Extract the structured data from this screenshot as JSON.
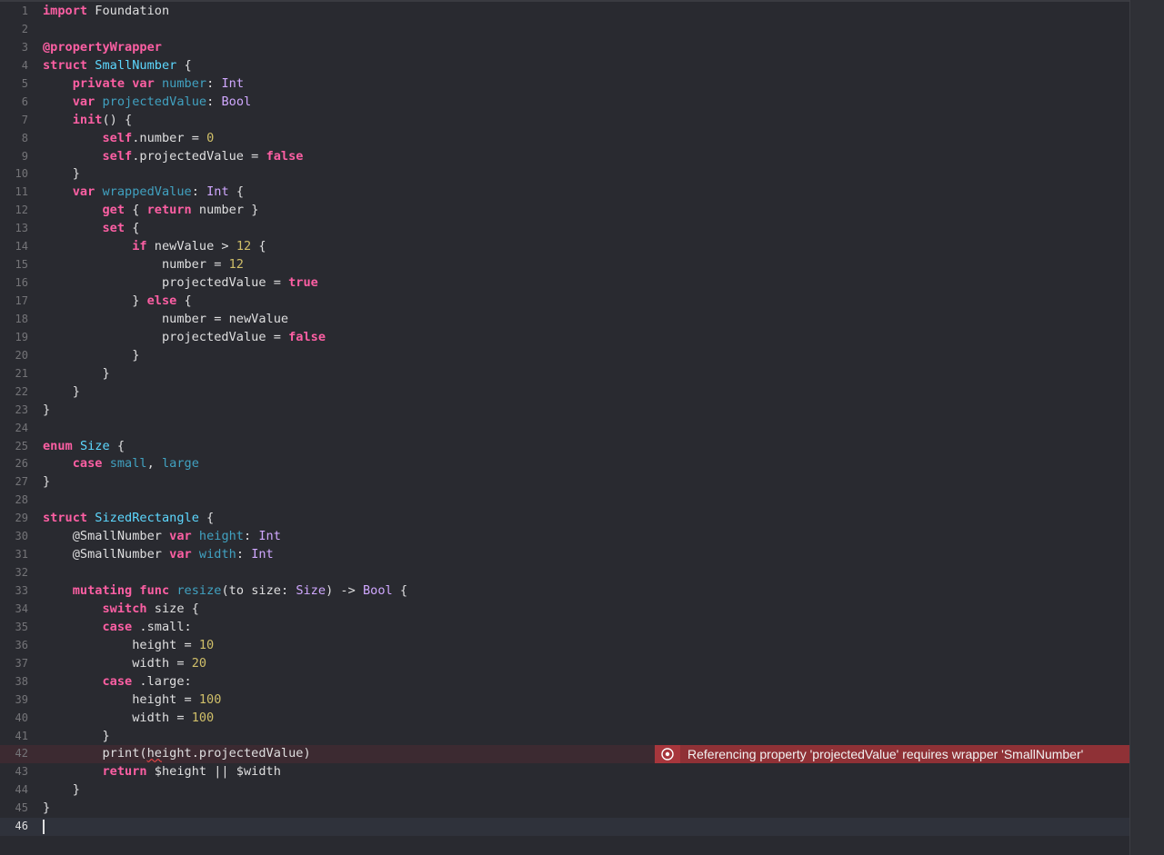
{
  "editor": {
    "language": "Swift",
    "current_line": 46,
    "colors": {
      "background": "#292a30",
      "keyword": "#fc5fa3",
      "type": "#5dd8ff",
      "type_ref": "#d0a8ff",
      "declaration": "#41a1c0",
      "number": "#d0bf69",
      "plain": "#dfdfe0",
      "line_number": "#747478",
      "error_banner": "#8f3136"
    },
    "lines": [
      {
        "n": "1",
        "tokens": [
          {
            "t": "import",
            "c": "kw"
          },
          {
            "t": " Foundation",
            "c": "plain"
          }
        ]
      },
      {
        "n": "2",
        "tokens": []
      },
      {
        "n": "3",
        "tokens": [
          {
            "t": "@propertyWrapper",
            "c": "attr"
          }
        ]
      },
      {
        "n": "4",
        "tokens": [
          {
            "t": "struct",
            "c": "kw"
          },
          {
            "t": " ",
            "c": "plain"
          },
          {
            "t": "SmallNumber",
            "c": "type"
          },
          {
            "t": " {",
            "c": "plain"
          }
        ]
      },
      {
        "n": "5",
        "tokens": [
          {
            "t": "    ",
            "c": "plain"
          },
          {
            "t": "private",
            "c": "kw"
          },
          {
            "t": " ",
            "c": "plain"
          },
          {
            "t": "var",
            "c": "kw"
          },
          {
            "t": " ",
            "c": "plain"
          },
          {
            "t": "number",
            "c": "decl"
          },
          {
            "t": ": ",
            "c": "plain"
          },
          {
            "t": "Int",
            "c": "tref"
          }
        ]
      },
      {
        "n": "6",
        "tokens": [
          {
            "t": "    ",
            "c": "plain"
          },
          {
            "t": "var",
            "c": "kw"
          },
          {
            "t": " ",
            "c": "plain"
          },
          {
            "t": "projectedValue",
            "c": "decl"
          },
          {
            "t": ": ",
            "c": "plain"
          },
          {
            "t": "Bool",
            "c": "tref"
          }
        ]
      },
      {
        "n": "7",
        "tokens": [
          {
            "t": "    ",
            "c": "plain"
          },
          {
            "t": "init",
            "c": "kw"
          },
          {
            "t": "() {",
            "c": "plain"
          }
        ]
      },
      {
        "n": "8",
        "tokens": [
          {
            "t": "        ",
            "c": "plain"
          },
          {
            "t": "self",
            "c": "kw"
          },
          {
            "t": ".number = ",
            "c": "plain"
          },
          {
            "t": "0",
            "c": "num"
          }
        ]
      },
      {
        "n": "9",
        "tokens": [
          {
            "t": "        ",
            "c": "plain"
          },
          {
            "t": "self",
            "c": "kw"
          },
          {
            "t": ".projectedValue = ",
            "c": "plain"
          },
          {
            "t": "false",
            "c": "kw"
          }
        ]
      },
      {
        "n": "10",
        "tokens": [
          {
            "t": "    }",
            "c": "plain"
          }
        ]
      },
      {
        "n": "11",
        "tokens": [
          {
            "t": "    ",
            "c": "plain"
          },
          {
            "t": "var",
            "c": "kw"
          },
          {
            "t": " ",
            "c": "plain"
          },
          {
            "t": "wrappedValue",
            "c": "decl"
          },
          {
            "t": ": ",
            "c": "plain"
          },
          {
            "t": "Int",
            "c": "tref"
          },
          {
            "t": " {",
            "c": "plain"
          }
        ]
      },
      {
        "n": "12",
        "tokens": [
          {
            "t": "        ",
            "c": "plain"
          },
          {
            "t": "get",
            "c": "kw"
          },
          {
            "t": " { ",
            "c": "plain"
          },
          {
            "t": "return",
            "c": "kw"
          },
          {
            "t": " number }",
            "c": "plain"
          }
        ]
      },
      {
        "n": "13",
        "tokens": [
          {
            "t": "        ",
            "c": "plain"
          },
          {
            "t": "set",
            "c": "kw"
          },
          {
            "t": " {",
            "c": "plain"
          }
        ]
      },
      {
        "n": "14",
        "tokens": [
          {
            "t": "            ",
            "c": "plain"
          },
          {
            "t": "if",
            "c": "kw"
          },
          {
            "t": " newValue > ",
            "c": "plain"
          },
          {
            "t": "12",
            "c": "num"
          },
          {
            "t": " {",
            "c": "plain"
          }
        ]
      },
      {
        "n": "15",
        "tokens": [
          {
            "t": "                number = ",
            "c": "plain"
          },
          {
            "t": "12",
            "c": "num"
          }
        ]
      },
      {
        "n": "16",
        "tokens": [
          {
            "t": "                projectedValue = ",
            "c": "plain"
          },
          {
            "t": "true",
            "c": "kw"
          }
        ]
      },
      {
        "n": "17",
        "tokens": [
          {
            "t": "            } ",
            "c": "plain"
          },
          {
            "t": "else",
            "c": "kw"
          },
          {
            "t": " {",
            "c": "plain"
          }
        ]
      },
      {
        "n": "18",
        "tokens": [
          {
            "t": "                number = newValue",
            "c": "plain"
          }
        ]
      },
      {
        "n": "19",
        "tokens": [
          {
            "t": "                projectedValue = ",
            "c": "plain"
          },
          {
            "t": "false",
            "c": "kw"
          }
        ]
      },
      {
        "n": "20",
        "tokens": [
          {
            "t": "            }",
            "c": "plain"
          }
        ]
      },
      {
        "n": "21",
        "tokens": [
          {
            "t": "        }",
            "c": "plain"
          }
        ]
      },
      {
        "n": "22",
        "tokens": [
          {
            "t": "    }",
            "c": "plain"
          }
        ]
      },
      {
        "n": "23",
        "tokens": [
          {
            "t": "}",
            "c": "plain"
          }
        ]
      },
      {
        "n": "24",
        "tokens": []
      },
      {
        "n": "25",
        "tokens": [
          {
            "t": "enum",
            "c": "kw"
          },
          {
            "t": " ",
            "c": "plain"
          },
          {
            "t": "Size",
            "c": "type"
          },
          {
            "t": " {",
            "c": "plain"
          }
        ]
      },
      {
        "n": "26",
        "tokens": [
          {
            "t": "    ",
            "c": "plain"
          },
          {
            "t": "case",
            "c": "kw"
          },
          {
            "t": " ",
            "c": "plain"
          },
          {
            "t": "small",
            "c": "decl"
          },
          {
            "t": ", ",
            "c": "plain"
          },
          {
            "t": "large",
            "c": "decl"
          }
        ]
      },
      {
        "n": "27",
        "tokens": [
          {
            "t": "}",
            "c": "plain"
          }
        ]
      },
      {
        "n": "28",
        "tokens": []
      },
      {
        "n": "29",
        "tokens": [
          {
            "t": "struct",
            "c": "kw"
          },
          {
            "t": " ",
            "c": "plain"
          },
          {
            "t": "SizedRectangle",
            "c": "type"
          },
          {
            "t": " {",
            "c": "plain"
          }
        ]
      },
      {
        "n": "30",
        "tokens": [
          {
            "t": "    @SmallNumber ",
            "c": "plain"
          },
          {
            "t": "var",
            "c": "kw"
          },
          {
            "t": " ",
            "c": "plain"
          },
          {
            "t": "height",
            "c": "decl"
          },
          {
            "t": ": ",
            "c": "plain"
          },
          {
            "t": "Int",
            "c": "tref"
          }
        ]
      },
      {
        "n": "31",
        "tokens": [
          {
            "t": "    @SmallNumber ",
            "c": "plain"
          },
          {
            "t": "var",
            "c": "kw"
          },
          {
            "t": " ",
            "c": "plain"
          },
          {
            "t": "width",
            "c": "decl"
          },
          {
            "t": ": ",
            "c": "plain"
          },
          {
            "t": "Int",
            "c": "tref"
          }
        ]
      },
      {
        "n": "32",
        "tokens": []
      },
      {
        "n": "33",
        "tokens": [
          {
            "t": "    ",
            "c": "plain"
          },
          {
            "t": "mutating",
            "c": "kw"
          },
          {
            "t": " ",
            "c": "plain"
          },
          {
            "t": "func",
            "c": "kw"
          },
          {
            "t": " ",
            "c": "plain"
          },
          {
            "t": "resize",
            "c": "decl"
          },
          {
            "t": "(to size: ",
            "c": "plain"
          },
          {
            "t": "Size",
            "c": "tref"
          },
          {
            "t": ") -> ",
            "c": "plain"
          },
          {
            "t": "Bool",
            "c": "tref"
          },
          {
            "t": " {",
            "c": "plain"
          }
        ]
      },
      {
        "n": "34",
        "tokens": [
          {
            "t": "        ",
            "c": "plain"
          },
          {
            "t": "switch",
            "c": "kw"
          },
          {
            "t": " size {",
            "c": "plain"
          }
        ]
      },
      {
        "n": "35",
        "tokens": [
          {
            "t": "        ",
            "c": "plain"
          },
          {
            "t": "case",
            "c": "kw"
          },
          {
            "t": " .small:",
            "c": "plain"
          }
        ]
      },
      {
        "n": "36",
        "tokens": [
          {
            "t": "            height = ",
            "c": "plain"
          },
          {
            "t": "10",
            "c": "num"
          }
        ]
      },
      {
        "n": "37",
        "tokens": [
          {
            "t": "            width = ",
            "c": "plain"
          },
          {
            "t": "20",
            "c": "num"
          }
        ]
      },
      {
        "n": "38",
        "tokens": [
          {
            "t": "        ",
            "c": "plain"
          },
          {
            "t": "case",
            "c": "kw"
          },
          {
            "t": " .large:",
            "c": "plain"
          }
        ]
      },
      {
        "n": "39",
        "tokens": [
          {
            "t": "            height = ",
            "c": "plain"
          },
          {
            "t": "100",
            "c": "num"
          }
        ]
      },
      {
        "n": "40",
        "tokens": [
          {
            "t": "            width = ",
            "c": "plain"
          },
          {
            "t": "100",
            "c": "num"
          }
        ]
      },
      {
        "n": "41",
        "tokens": [
          {
            "t": "        }",
            "c": "plain"
          }
        ]
      },
      {
        "n": "42",
        "error": true,
        "tokens": [
          {
            "t": "        print(",
            "c": "plain"
          },
          {
            "t": "he",
            "c": "plain",
            "sq": true
          },
          {
            "t": "ight.projectedValue)",
            "c": "plain"
          }
        ]
      },
      {
        "n": "43",
        "tokens": [
          {
            "t": "        ",
            "c": "plain"
          },
          {
            "t": "return",
            "c": "kw"
          },
          {
            "t": " $height || $width",
            "c": "plain"
          }
        ]
      },
      {
        "n": "44",
        "tokens": [
          {
            "t": "    }",
            "c": "plain"
          }
        ]
      },
      {
        "n": "45",
        "tokens": [
          {
            "t": "}",
            "c": "plain"
          }
        ]
      },
      {
        "n": "46",
        "current": true,
        "tokens": []
      }
    ]
  },
  "error": {
    "line": 42,
    "icon": "error-circle-icon",
    "message": "Referencing property 'projectedValue' requires wrapper 'SmallNumber'"
  }
}
